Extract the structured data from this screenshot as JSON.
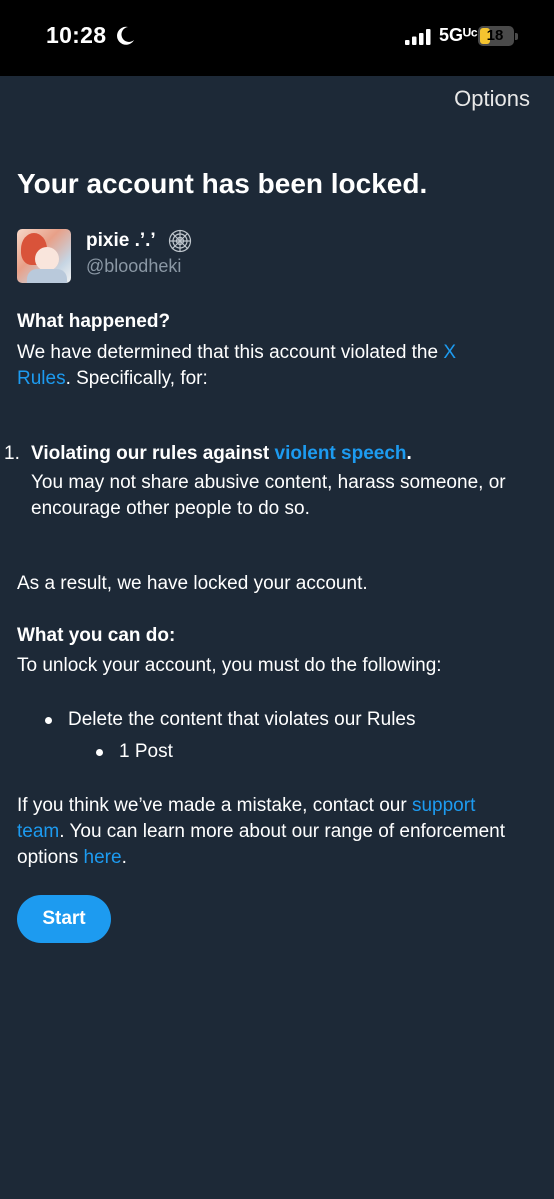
{
  "status_bar": {
    "time": "10:28",
    "network": "5Gᵁᶜ",
    "battery": "18"
  },
  "header": {
    "options_label": "Options"
  },
  "page": {
    "title": "Your account has been locked."
  },
  "account": {
    "display_name": "pixie .’.’",
    "handle": "@bloodheki"
  },
  "what_happened": {
    "title": "What happened?",
    "text_before": "We have determined that this account violated the ",
    "rules_link_line1": "X",
    "rules_link_line2": "Rules",
    "text_after": ". Specifically, for:"
  },
  "violation": {
    "number": "1.",
    "title_before": "Violating our rules against ",
    "title_link": "violent speech",
    "title_after": ".",
    "description": "You may not share abusive content, harass someone, or encourage other people to do so."
  },
  "result_text": "As a result, we have locked your account.",
  "what_you_can_do": {
    "title": "What you can do:",
    "text": "To unlock your account, you must do the following:",
    "items": [
      {
        "label": "Delete the content that violates our Rules"
      },
      {
        "label": "1 Post"
      }
    ]
  },
  "mistake": {
    "text_before": "If you think we’ve made a mistake, contact our ",
    "support_link_line1": "support",
    "support_link_line2": "team",
    "text_middle": ". You can learn more about our range of enforcement options ",
    "here_link": "here",
    "text_after": "."
  },
  "actions": {
    "start_label": "Start"
  },
  "colors": {
    "background": "#1d2937",
    "accent": "#1d9bf0",
    "secondary_text": "#8b98a5"
  }
}
